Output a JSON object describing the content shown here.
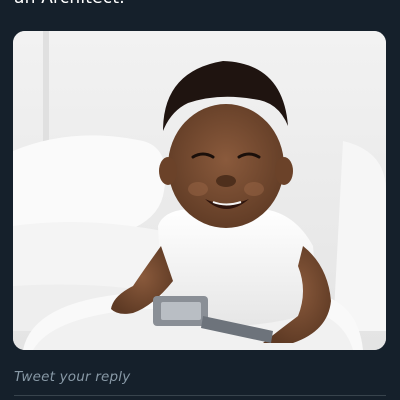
{
  "tweet": {
    "text": "an Architect."
  },
  "media": {
    "image_icon": "photo-baby-smiling"
  },
  "reply": {
    "placeholder": "Tweet your reply"
  },
  "colors": {
    "background": "#15202b",
    "text_primary": "#ffffff",
    "text_secondary": "#8899a6",
    "divider": "#38444d"
  }
}
